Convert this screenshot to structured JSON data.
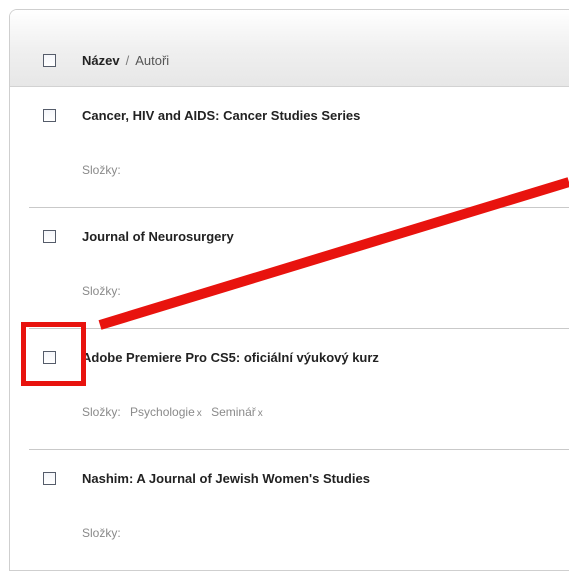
{
  "header": {
    "title": "Název",
    "separator": "/",
    "authors": "Autoři"
  },
  "rows": [
    {
      "title": "Cancer, HIV and AIDS: Cancer Studies Series",
      "folders_label": "Složky:",
      "folders": []
    },
    {
      "title": "Journal of Neurosurgery",
      "folders_label": "Složky:",
      "folders": []
    },
    {
      "title": "Adobe Premiere Pro CS5: oficiální výukový kurz",
      "folders_label": "Složky:",
      "folders": [
        {
          "name": "Psychologie",
          "remove": "x"
        },
        {
          "name": "Seminář",
          "remove": "x"
        }
      ]
    },
    {
      "title": "Nashim: A Journal of Jewish Women's Studies",
      "folders_label": "Složky:",
      "folders": []
    }
  ],
  "annotation": {
    "color": "#e8130e"
  }
}
